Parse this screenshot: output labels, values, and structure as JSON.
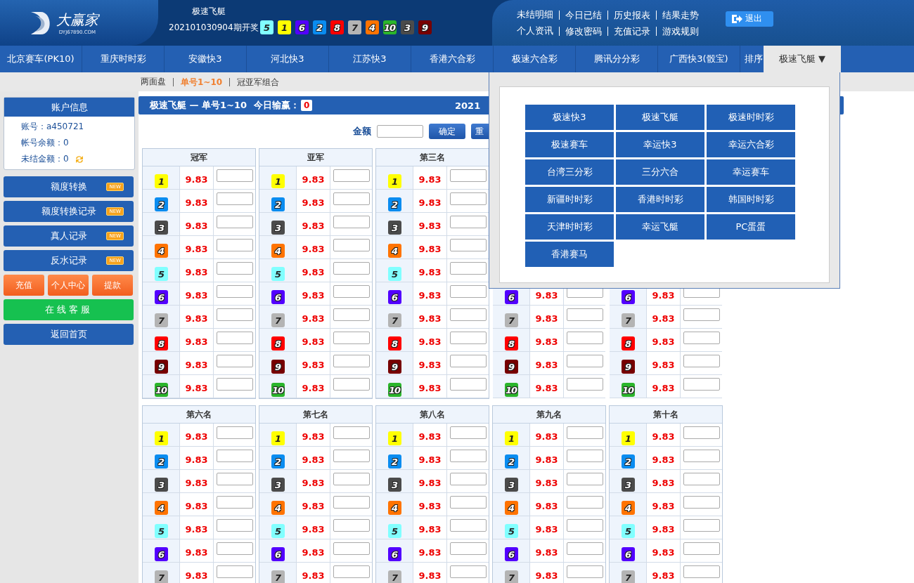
{
  "header": {
    "logo": {
      "name": "大赢家",
      "url": "DYJ67890.COM"
    },
    "game_title": "极速飞艇",
    "draw_label": "202101030904期开奖",
    "draw_balls": [
      {
        "number": "5",
        "color": "#81ffff"
      },
      {
        "number": "1",
        "color": "#ffff00"
      },
      {
        "number": "6",
        "color": "#5200ff"
      },
      {
        "number": "2",
        "color": "#0a8cf0"
      },
      {
        "number": "8",
        "color": "#ff0000"
      },
      {
        "number": "7",
        "color": "#b4b4b4"
      },
      {
        "number": "4",
        "color": "#ff7300"
      },
      {
        "number": "10",
        "color": "#2bb52b"
      },
      {
        "number": "3",
        "color": "#4b4b4b"
      },
      {
        "number": "9",
        "color": "#770000"
      }
    ],
    "links": [
      [
        "未结明细",
        "今日已结",
        "历史报表",
        "结果走势"
      ],
      [
        "个人资讯",
        "修改密码",
        "充值记录",
        "游戏规则"
      ]
    ],
    "logout": "退出"
  },
  "nav": [
    {
      "label": "北京赛车(PK10)",
      "selected": false
    },
    {
      "label": "重庆时时彩",
      "selected": false
    },
    {
      "label": "安徽快3",
      "selected": false
    },
    {
      "label": "河北快3",
      "selected": false
    },
    {
      "label": "江苏快3",
      "selected": false
    },
    {
      "label": "香港六合彩",
      "selected": false
    },
    {
      "label": "极速六合彩",
      "selected": false
    },
    {
      "label": "腾讯分分彩",
      "selected": false
    },
    {
      "label": "广西快3(骰宝)",
      "selected": false
    },
    {
      "label": "排序",
      "selected": false
    },
    {
      "label": "极速飞艇 ▼",
      "selected": true
    }
  ],
  "subnav": [
    {
      "label": "两面盘",
      "selected": false
    },
    {
      "label": "单号1~10",
      "selected": true
    },
    {
      "label": "冠亚军组合",
      "selected": false
    }
  ],
  "sidebar": {
    "account": {
      "title": "账户信息",
      "lines": [
        {
          "label": "账号：a450721"
        },
        {
          "label": "帐号余额：0"
        },
        {
          "label": "未结金额：0",
          "refresh": true
        }
      ]
    },
    "menu": [
      {
        "label": "额度转换",
        "badge": "NEW"
      },
      {
        "label": "额度转换记录",
        "badge": "NEW"
      },
      {
        "label": "真人记录",
        "badge": "NEW"
      },
      {
        "label": "反水记录",
        "badge": "NEW"
      }
    ],
    "actions": [
      "充值",
      "个人中心",
      "提款"
    ],
    "service": "在线客服",
    "home": "返回首页"
  },
  "panel": {
    "title": "极速飞艇 — 单号1~10",
    "today_label": "今日输赢：",
    "today_value": "0",
    "date": "2021",
    "amount_label": "金额",
    "confirm": "确定",
    "reset": "重",
    "board_groups": [
      [
        {
          "title": "冠军",
          "rows": [
            {
              "ball": "1",
              "color": "#ffff00",
              "odds": "9.83"
            },
            {
              "ball": "2",
              "color": "#0a8cf0",
              "odds": "9.83"
            },
            {
              "ball": "3",
              "color": "#4b4b4b",
              "odds": "9.83"
            },
            {
              "ball": "4",
              "color": "#ff7300",
              "odds": "9.83"
            },
            {
              "ball": "5",
              "color": "#81ffff",
              "odds": "9.83"
            },
            {
              "ball": "6",
              "color": "#5200ff",
              "odds": "9.83"
            },
            {
              "ball": "7",
              "color": "#b4b4b4",
              "odds": "9.83"
            },
            {
              "ball": "8",
              "color": "#ff0000",
              "odds": "9.83"
            },
            {
              "ball": "9",
              "color": "#770000",
              "odds": "9.83"
            },
            {
              "ball": "10",
              "color": "#2bb52b",
              "odds": "9.83"
            }
          ]
        },
        {
          "title": "亚军",
          "rows": [
            {
              "ball": "1",
              "color": "#ffff00",
              "odds": "9.83"
            },
            {
              "ball": "2",
              "color": "#0a8cf0",
              "odds": "9.83"
            },
            {
              "ball": "3",
              "color": "#4b4b4b",
              "odds": "9.83"
            },
            {
              "ball": "4",
              "color": "#ff7300",
              "odds": "9.83"
            },
            {
              "ball": "5",
              "color": "#81ffff",
              "odds": "9.83"
            },
            {
              "ball": "6",
              "color": "#5200ff",
              "odds": "9.83"
            },
            {
              "ball": "7",
              "color": "#b4b4b4",
              "odds": "9.83"
            },
            {
              "ball": "8",
              "color": "#ff0000",
              "odds": "9.83"
            },
            {
              "ball": "9",
              "color": "#770000",
              "odds": "9.83"
            },
            {
              "ball": "10",
              "color": "#2bb52b",
              "odds": "9.83"
            }
          ]
        },
        {
          "title": "第三名",
          "rows": [
            {
              "ball": "1",
              "color": "#ffff00",
              "odds": "9.83"
            },
            {
              "ball": "2",
              "color": "#0a8cf0",
              "odds": "9.83"
            },
            {
              "ball": "3",
              "color": "#4b4b4b",
              "odds": "9.83"
            },
            {
              "ball": "4",
              "color": "#ff7300",
              "odds": "9.83"
            },
            {
              "ball": "5",
              "color": "#81ffff",
              "odds": "9.83"
            },
            {
              "ball": "6",
              "color": "#5200ff",
              "odds": "9.83"
            },
            {
              "ball": "7",
              "color": "#b4b4b4",
              "odds": "9.83"
            },
            {
              "ball": "8",
              "color": "#ff0000",
              "odds": "9.83"
            },
            {
              "ball": "9",
              "color": "#770000",
              "odds": "9.83"
            },
            {
              "ball": "10",
              "color": "#2bb52b",
              "odds": "9.83"
            }
          ]
        },
        {
          "rows": [
            {
              "ball": "6",
              "color": "#5200ff",
              "odds": "9.83"
            },
            {
              "ball": "7",
              "color": "#b4b4b4",
              "odds": "9.83"
            },
            {
              "ball": "8",
              "color": "#ff0000",
              "odds": "9.83"
            },
            {
              "ball": "9",
              "color": "#770000",
              "odds": "9.83"
            },
            {
              "ball": "10",
              "color": "#2bb52b",
              "odds": "9.83"
            }
          ]
        },
        {
          "rows": [
            {
              "ball": "6",
              "color": "#5200ff",
              "odds": "9.83"
            },
            {
              "ball": "7",
              "color": "#b4b4b4",
              "odds": "9.83"
            },
            {
              "ball": "8",
              "color": "#ff0000",
              "odds": "9.83"
            },
            {
              "ball": "9",
              "color": "#770000",
              "odds": "9.83"
            },
            {
              "ball": "10",
              "color": "#2bb52b",
              "odds": "9.83"
            }
          ]
        }
      ],
      [
        {
          "title": "第六名",
          "rows": [
            {
              "ball": "1",
              "color": "#ffff00",
              "odds": "9.83"
            },
            {
              "ball": "2",
              "color": "#0a8cf0",
              "odds": "9.83"
            },
            {
              "ball": "3",
              "color": "#4b4b4b",
              "odds": "9.83"
            },
            {
              "ball": "4",
              "color": "#ff7300",
              "odds": "9.83"
            },
            {
              "ball": "5",
              "color": "#81ffff",
              "odds": "9.83"
            },
            {
              "ball": "6",
              "color": "#5200ff",
              "odds": "9.83"
            },
            {
              "ball": "7",
              "color": "#b4b4b4",
              "odds": "9.83"
            }
          ]
        },
        {
          "title": "第七名",
          "rows": [
            {
              "ball": "1",
              "color": "#ffff00",
              "odds": "9.83"
            },
            {
              "ball": "2",
              "color": "#0a8cf0",
              "odds": "9.83"
            },
            {
              "ball": "3",
              "color": "#4b4b4b",
              "odds": "9.83"
            },
            {
              "ball": "4",
              "color": "#ff7300",
              "odds": "9.83"
            },
            {
              "ball": "5",
              "color": "#81ffff",
              "odds": "9.83"
            },
            {
              "ball": "6",
              "color": "#5200ff",
              "odds": "9.83"
            },
            {
              "ball": "7",
              "color": "#b4b4b4",
              "odds": "9.83"
            }
          ]
        },
        {
          "title": "第八名",
          "rows": [
            {
              "ball": "1",
              "color": "#ffff00",
              "odds": "9.83"
            },
            {
              "ball": "2",
              "color": "#0a8cf0",
              "odds": "9.83"
            },
            {
              "ball": "3",
              "color": "#4b4b4b",
              "odds": "9.83"
            },
            {
              "ball": "4",
              "color": "#ff7300",
              "odds": "9.83"
            },
            {
              "ball": "5",
              "color": "#81ffff",
              "odds": "9.83"
            },
            {
              "ball": "6",
              "color": "#5200ff",
              "odds": "9.83"
            },
            {
              "ball": "7",
              "color": "#b4b4b4",
              "odds": "9.83"
            }
          ]
        },
        {
          "title": "第九名",
          "rows": [
            {
              "ball": "1",
              "color": "#ffff00",
              "odds": "9.83"
            },
            {
              "ball": "2",
              "color": "#0a8cf0",
              "odds": "9.83"
            },
            {
              "ball": "3",
              "color": "#4b4b4b",
              "odds": "9.83"
            },
            {
              "ball": "4",
              "color": "#ff7300",
              "odds": "9.83"
            },
            {
              "ball": "5",
              "color": "#81ffff",
              "odds": "9.83"
            },
            {
              "ball": "6",
              "color": "#5200ff",
              "odds": "9.83"
            },
            {
              "ball": "7",
              "color": "#b4b4b4",
              "odds": "9.83"
            }
          ]
        },
        {
          "title": "第十名",
          "rows": [
            {
              "ball": "1",
              "color": "#ffff00",
              "odds": "9.83"
            },
            {
              "ball": "2",
              "color": "#0a8cf0",
              "odds": "9.83"
            },
            {
              "ball": "3",
              "color": "#4b4b4b",
              "odds": "9.83"
            },
            {
              "ball": "4",
              "color": "#ff7300",
              "odds": "9.83"
            },
            {
              "ball": "5",
              "color": "#81ffff",
              "odds": "9.83"
            },
            {
              "ball": "6",
              "color": "#5200ff",
              "odds": "9.83"
            },
            {
              "ball": "7",
              "color": "#b4b4b4",
              "odds": "9.83"
            }
          ]
        }
      ]
    ]
  },
  "game_menu": [
    "极速快3",
    "极速飞艇",
    "极速时时彩",
    "极速赛车",
    "幸运快3",
    "幸运六合彩",
    "台湾三分彩",
    "三分六合",
    "幸运赛车",
    "新疆时时彩",
    "香港时时彩",
    "韩国时时彩",
    "天津时时彩",
    "幸运飞艇",
    "PC蛋蛋",
    "香港赛马"
  ]
}
